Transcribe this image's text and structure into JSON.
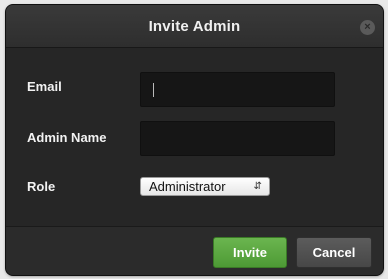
{
  "dialog": {
    "title": "Invite Admin",
    "close_icon": "close-icon"
  },
  "form": {
    "email": {
      "label": "Email",
      "value": ""
    },
    "admin_name": {
      "label": "Admin Name",
      "value": ""
    },
    "role": {
      "label": "Role",
      "selected": "Administrator"
    }
  },
  "footer": {
    "invite_label": "Invite",
    "cancel_label": "Cancel"
  },
  "colors": {
    "primary_button": "#5ba842",
    "secondary_button": "#525252",
    "dialog_background": "#262626"
  }
}
